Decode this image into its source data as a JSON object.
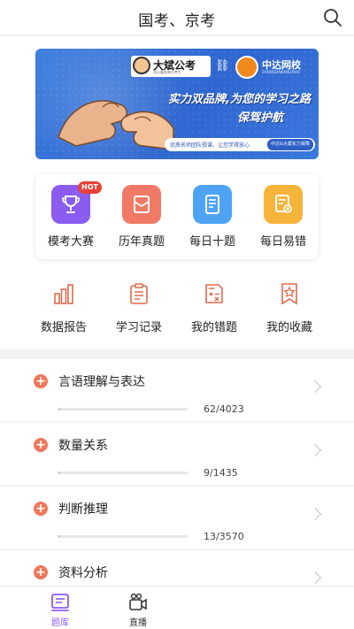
{
  "header": {
    "title": "国考、京考",
    "search_icon": "search-icon"
  },
  "banner": {
    "logo_primary": "大斌公考",
    "logo_primary_sub": "用心服务每位考生",
    "link_icon": "link-icon",
    "logo_secondary": "中达网校",
    "logo_secondary_sub": "ZHONGDAWANGXIAO",
    "slogan_line1": "实力双品牌,为您的学习之路",
    "slogan_line2": "保驾护航",
    "note": "优质名师团队授课，让您学得放心",
    "note_tag": "中达&大斌实力保障"
  },
  "features": [
    {
      "label": "模考大赛",
      "icon": "trophy-icon",
      "color": "#8a5cf0",
      "badge": "HOT"
    },
    {
      "label": "历年真题",
      "icon": "paper-icon",
      "color": "#f07a66"
    },
    {
      "label": "每日十题",
      "icon": "tablet-icon",
      "color": "#4ea3f5"
    },
    {
      "label": "每日易错",
      "icon": "error-doc-icon",
      "color": "#f6b43a"
    }
  ],
  "tools": [
    {
      "label": "数据报告",
      "icon": "bar-chart-icon"
    },
    {
      "label": "学习记录",
      "icon": "clipboard-icon"
    },
    {
      "label": "我的错题",
      "icon": "wrong-doc-icon"
    },
    {
      "label": "我的收藏",
      "icon": "bookmark-star-icon"
    }
  ],
  "accent_color": "#f0775a",
  "categories": [
    {
      "name": "言语理解与表达",
      "count": "62/4023",
      "progress": 0.0154
    },
    {
      "name": "数量关系",
      "count": "9/1435",
      "progress": 0.0063
    },
    {
      "name": "判断推理",
      "count": "13/3570",
      "progress": 0.0036
    },
    {
      "name": "资料分析",
      "count": "",
      "progress": 0
    }
  ],
  "bottom_nav": [
    {
      "label": "题库",
      "icon": "question-bank-icon",
      "active": true,
      "color": "#8a5cf0"
    },
    {
      "label": "直播",
      "icon": "camera-icon",
      "active": false,
      "color": "#333333"
    }
  ]
}
